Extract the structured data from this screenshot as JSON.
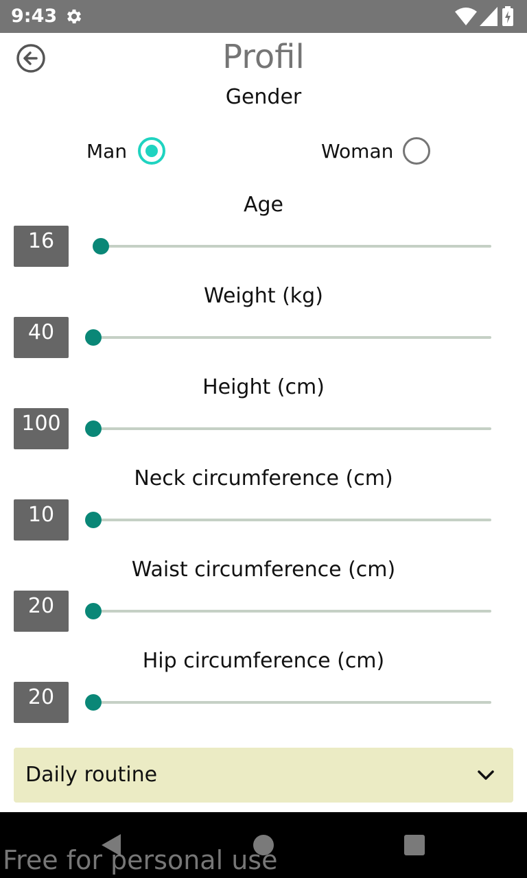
{
  "status_bar": {
    "time": "9:43",
    "icons": [
      "gear-icon",
      "wifi-icon",
      "signal-icon",
      "battery-icon"
    ]
  },
  "header": {
    "title": "Profil",
    "back_icon": "arrow-left-circle-icon"
  },
  "gender": {
    "label": "Gender",
    "options": [
      {
        "label": "Man",
        "selected": true
      },
      {
        "label": "Woman",
        "selected": false
      }
    ],
    "accent_color": "#1fd3c0"
  },
  "sliders": [
    {
      "label": "Age",
      "value": "16"
    },
    {
      "label": "Weight (kg)",
      "value": "40"
    },
    {
      "label": "Height (cm)",
      "value": "100"
    },
    {
      "label": "Neck circumference (cm)",
      "value": "10"
    },
    {
      "label": "Waist circumference (cm)",
      "value": "20"
    },
    {
      "label": "Hip circumference (cm)",
      "value": "20"
    }
  ],
  "daily_routine": {
    "label": "Daily routine",
    "icon": "chevron-down-icon",
    "background": "#ebebc4"
  },
  "nav_bar": {
    "buttons": [
      "back-triangle-icon",
      "home-circle-icon",
      "recents-square-icon"
    ]
  },
  "watermark": "Free for personal use",
  "colors": {
    "status_bar": "#757575",
    "slider_thumb": "#0a8777",
    "slider_track": "#c5d0c5",
    "value_box": "#666666"
  }
}
